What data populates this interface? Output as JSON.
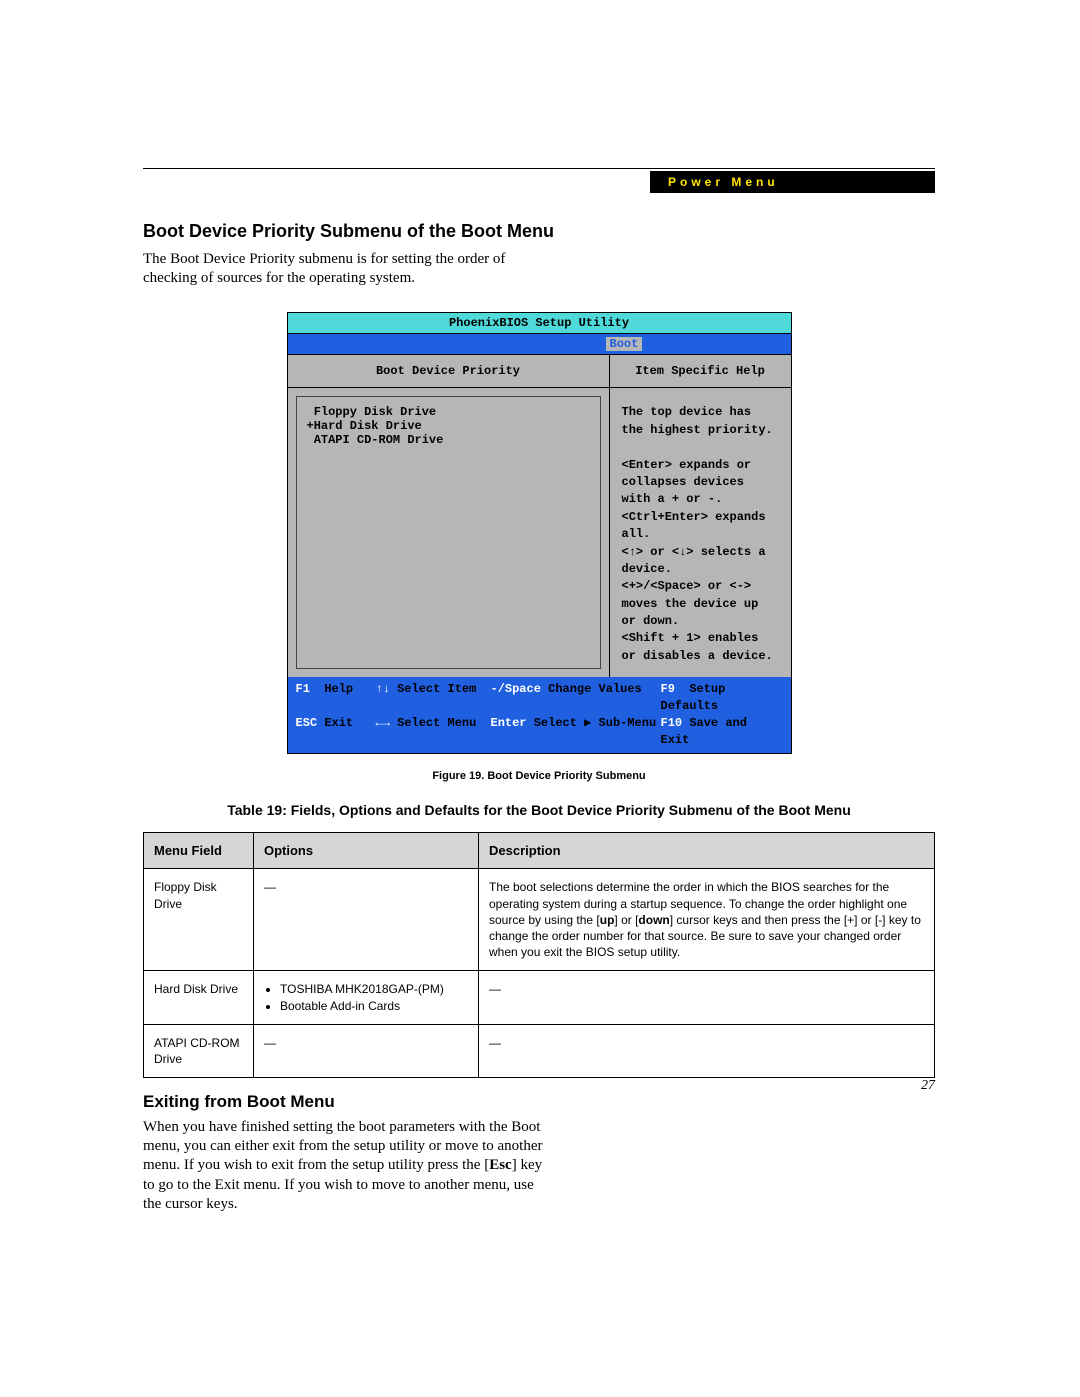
{
  "header": {
    "tab_label": "Power Menu"
  },
  "section1": {
    "heading": "Boot Device Priority Submenu of the Boot Menu",
    "para": "The Boot Device Priority submenu is for setting the order of checking of sources for the operating system."
  },
  "bios": {
    "title": "PhoenixBIOS Setup Utility",
    "menu_tab": "Boot",
    "left_head": "Boot Device Priority",
    "right_head": "Item Specific Help",
    "devices": [
      " Floppy Disk Drive",
      "+Hard Disk Drive",
      " ATAPI CD-ROM Drive"
    ],
    "help_text": "The top device has the highest priority.\n\n<Enter> expands or collapses devices with a + or -.\n<Ctrl+Enter> expands all.\n<↑> or <↓> selects a device.\n<+>/<Space> or <-> moves the device up or down.\n<Shift + 1> enables or disables a device.",
    "footer": {
      "r1": {
        "k1": "F1",
        "l1": "Help",
        "k2": "↑↓",
        "l2": "Select Item",
        "k3": "-/Space",
        "l3": "Change Values",
        "k4": "F9",
        "l4": "Setup Defaults"
      },
      "r2": {
        "k1": "ESC",
        "l1": "Exit",
        "k2": "←→",
        "l2": "Select Menu",
        "k3": "Enter",
        "l3": "Select ▶ Sub-Menu",
        "k4": "F10",
        "l4": "Save and Exit"
      }
    }
  },
  "figure_caption": "Figure 19.  Boot Device Priority Submenu",
  "table_title": "Table 19: Fields, Options and Defaults for the Boot Device Priority Submenu of the Boot Menu",
  "table": {
    "headers": [
      "Menu Field",
      "Options",
      "Description"
    ],
    "rows": [
      {
        "field": "Floppy Disk Drive",
        "options_dash": "—",
        "options_list": [],
        "desc": "The boot selections determine the order in which the BIOS searches for the operating system during a startup sequence. To change the order highlight one source by using the [up] or [down] cursor keys and then press the [+] or [-] key to change the order number for that source. Be sure to save your changed order when you exit the BIOS setup utility.",
        "desc_bold1": "up",
        "desc_bold2": "down"
      },
      {
        "field": "Hard Disk Drive",
        "options_dash": "",
        "options_list": [
          "TOSHIBA MHK2018GAP-(PM)",
          "Bootable Add-in Cards"
        ],
        "desc": "—"
      },
      {
        "field": "ATAPI CD-ROM Drive",
        "options_dash": "—",
        "options_list": [],
        "desc": "—"
      }
    ]
  },
  "section2": {
    "heading": "Exiting from Boot Menu",
    "para": "When you have finished setting the boot parameters with the Boot menu, you can either exit from the setup utility or move to another menu. If you wish to exit from the setup utility press the [Esc] key to go to the Exit menu. If you wish to move to another menu, use the cursor keys.",
    "bold": "Esc"
  },
  "page_number": "27"
}
